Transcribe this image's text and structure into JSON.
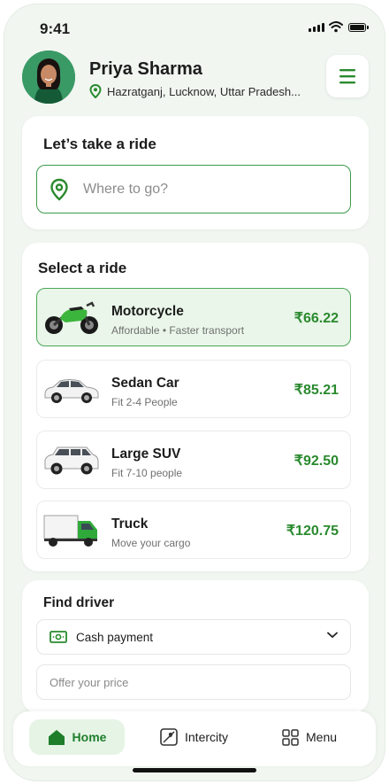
{
  "status_bar": {
    "time": "9:41"
  },
  "header": {
    "name": "Priya Sharma",
    "location": "Hazratganj, Lucknow, Uttar Pradesh..."
  },
  "ride_card": {
    "title": "Let’s take a ride",
    "search_placeholder": "Where to go?"
  },
  "select_ride": {
    "title": "Select a ride",
    "options": [
      {
        "name": "Motorcycle",
        "desc": "Affordable • Faster transport",
        "price": "₹66.22",
        "selected": true
      },
      {
        "name": "Sedan Car",
        "desc": "Fit 2-4 People",
        "price": "₹85.21",
        "selected": false
      },
      {
        "name": "Large SUV",
        "desc": "Fit 7-10 people",
        "price": "₹92.50",
        "selected": false
      },
      {
        "name": "Truck",
        "desc": "Move your cargo",
        "price": "₹120.75",
        "selected": false
      }
    ]
  },
  "find_driver": {
    "title": "Find driver",
    "payment": "Cash payment",
    "offer_placeholder": "Offer your price"
  },
  "bottom_nav": {
    "home": "Home",
    "intercity": "Intercity",
    "menu": "Menu"
  },
  "colors": {
    "accent": "#2a8a2e",
    "accent_light": "#e9f6e9",
    "background": "#f1f6f1"
  }
}
